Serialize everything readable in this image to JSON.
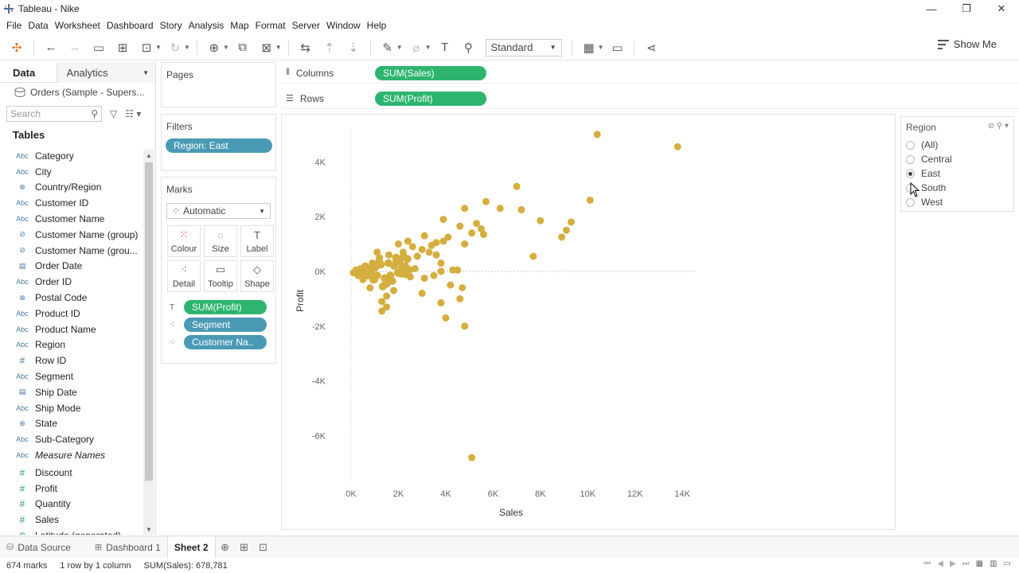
{
  "window": {
    "title": "Tableau - Nike",
    "controls": [
      "—",
      "❐",
      "✕"
    ]
  },
  "menu": [
    "File",
    "Data",
    "Worksheet",
    "Dashboard",
    "Story",
    "Analysis",
    "Map",
    "Format",
    "Server",
    "Window",
    "Help"
  ],
  "toolbar": {
    "fit_select": "Standard",
    "show_me": "Show Me"
  },
  "data_pane": {
    "tab_data": "Data",
    "tab_analytics": "Analytics",
    "datasource": "Orders (Sample - Supers...",
    "search_placeholder": "Search",
    "tables_header": "Tables",
    "dimensions": [
      {
        "type": "Abc",
        "name": "Category"
      },
      {
        "type": "Abc",
        "name": "City"
      },
      {
        "type": "globe",
        "name": "Country/Region"
      },
      {
        "type": "Abc",
        "name": "Customer ID"
      },
      {
        "type": "Abc",
        "name": "Customer Name"
      },
      {
        "type": "link",
        "name": "Customer Name (group)"
      },
      {
        "type": "link",
        "name": "Customer Name (grou..."
      },
      {
        "type": "date",
        "name": "Order Date"
      },
      {
        "type": "Abc",
        "name": "Order ID"
      },
      {
        "type": "globe",
        "name": "Postal Code"
      },
      {
        "type": "Abc",
        "name": "Product ID"
      },
      {
        "type": "Abc",
        "name": "Product Name"
      },
      {
        "type": "Abc",
        "name": "Region"
      },
      {
        "type": "#",
        "name": "Row ID"
      },
      {
        "type": "Abc",
        "name": "Segment"
      },
      {
        "type": "date",
        "name": "Ship Date"
      },
      {
        "type": "Abc",
        "name": "Ship Mode"
      },
      {
        "type": "globe",
        "name": "State"
      },
      {
        "type": "Abc",
        "name": "Sub-Category"
      },
      {
        "type": "Abc",
        "name": "Measure Names"
      }
    ],
    "measures": [
      {
        "type": "#",
        "name": "Discount"
      },
      {
        "type": "#",
        "name": "Profit"
      },
      {
        "type": "#",
        "name": "Quantity"
      },
      {
        "type": "#",
        "name": "Sales"
      },
      {
        "type": "globe",
        "name": "Latitude (generated)"
      }
    ]
  },
  "pages": {
    "header": "Pages"
  },
  "filters": {
    "header": "Filters",
    "pill": "Region: East"
  },
  "marks": {
    "header": "Marks",
    "type": "Automatic",
    "buttons": [
      {
        "label": "Colour",
        "icon": "colour-icon"
      },
      {
        "label": "Size",
        "icon": "size-icon"
      },
      {
        "label": "Label",
        "icon": "label-icon"
      },
      {
        "label": "Detail",
        "icon": "detail-icon"
      },
      {
        "label": "Tooltip",
        "icon": "tooltip-icon"
      },
      {
        "label": "Shape",
        "icon": "shape-icon"
      }
    ],
    "pills": [
      "SUM(Profit)",
      "Segment",
      "Customer Na.."
    ]
  },
  "shelves": {
    "columns_label": "Columns",
    "columns_pill": "SUM(Sales)",
    "rows_label": "Rows",
    "rows_pill": "SUM(Profit)"
  },
  "chart_data": {
    "type": "scatter",
    "xlabel": "Sales",
    "ylabel": "Profit",
    "x_ticks": [
      "0K",
      "2K",
      "4K",
      "6K",
      "8K",
      "10K",
      "12K",
      "14K"
    ],
    "y_ticks": [
      "4K",
      "2K",
      "0K",
      "-2K",
      "-4K",
      "-6K"
    ],
    "xlim": [
      0,
      14500
    ],
    "ylim": [
      -7700,
      5200
    ],
    "point_color": "#d4ae3f",
    "points": [
      [
        10400,
        5000
      ],
      [
        13800,
        4550
      ],
      [
        10100,
        2600
      ],
      [
        7000,
        3100
      ],
      [
        5700,
        2550
      ],
      [
        6300,
        2300
      ],
      [
        7200,
        2250
      ],
      [
        4800,
        2300
      ],
      [
        9300,
        1800
      ],
      [
        8000,
        1850
      ],
      [
        8900,
        1250
      ],
      [
        9100,
        1500
      ],
      [
        3900,
        1900
      ],
      [
        5300,
        1750
      ],
      [
        5500,
        1550
      ],
      [
        5600,
        1350
      ],
      [
        4600,
        1650
      ],
      [
        5100,
        1400
      ],
      [
        4800,
        1000
      ],
      [
        4100,
        1250
      ],
      [
        3900,
        1100
      ],
      [
        3600,
        1050
      ],
      [
        3400,
        950
      ],
      [
        3100,
        1300
      ],
      [
        3300,
        700
      ],
      [
        3600,
        600
      ],
      [
        3000,
        800
      ],
      [
        7700,
        550
      ],
      [
        2800,
        550
      ],
      [
        2600,
        900
      ],
      [
        3800,
        300
      ],
      [
        4300,
        50
      ],
      [
        4500,
        50
      ],
      [
        3800,
        0
      ],
      [
        3100,
        -250
      ],
      [
        3500,
        -150
      ],
      [
        4200,
        -500
      ],
      [
        4700,
        -600
      ],
      [
        4600,
        -1000
      ],
      [
        3800,
        -1150
      ],
      [
        3000,
        -800
      ],
      [
        1500,
        -900
      ],
      [
        1500,
        -1300
      ],
      [
        1300,
        -1100
      ],
      [
        4000,
        -1700
      ],
      [
        1300,
        -1450
      ],
      [
        4800,
        -2000
      ],
      [
        5100,
        -6800
      ],
      [
        2300,
        200
      ],
      [
        2100,
        -100
      ],
      [
        1900,
        400
      ],
      [
        2500,
        -200
      ],
      [
        2700,
        100
      ],
      [
        1700,
        -300
      ],
      [
        2200,
        700
      ],
      [
        1600,
        600
      ],
      [
        1200,
        500
      ],
      [
        900,
        300
      ],
      [
        700,
        -100
      ],
      [
        1000,
        -300
      ],
      [
        1400,
        -500
      ],
      [
        1800,
        -700
      ],
      [
        2000,
        1000
      ],
      [
        2400,
        1100
      ],
      [
        1100,
        700
      ],
      [
        600,
        200
      ],
      [
        400,
        100
      ],
      [
        200,
        50
      ],
      [
        100,
        -50
      ],
      [
        300,
        -150
      ],
      [
        500,
        -300
      ],
      [
        800,
        -600
      ]
    ]
  },
  "region_filter": {
    "header": "Region",
    "options": [
      {
        "label": "(All)",
        "selected": false
      },
      {
        "label": "Central",
        "selected": false
      },
      {
        "label": "East",
        "selected": true
      },
      {
        "label": "South",
        "selected": false
      },
      {
        "label": "West",
        "selected": false
      }
    ]
  },
  "sheet_tabs": {
    "data_source": "Data Source",
    "dashboard": "Dashboard 1",
    "active": "Sheet 2"
  },
  "status": {
    "marks": "674 marks",
    "dims": "1 row by 1 column",
    "sum": "SUM(Sales): 678,781"
  }
}
